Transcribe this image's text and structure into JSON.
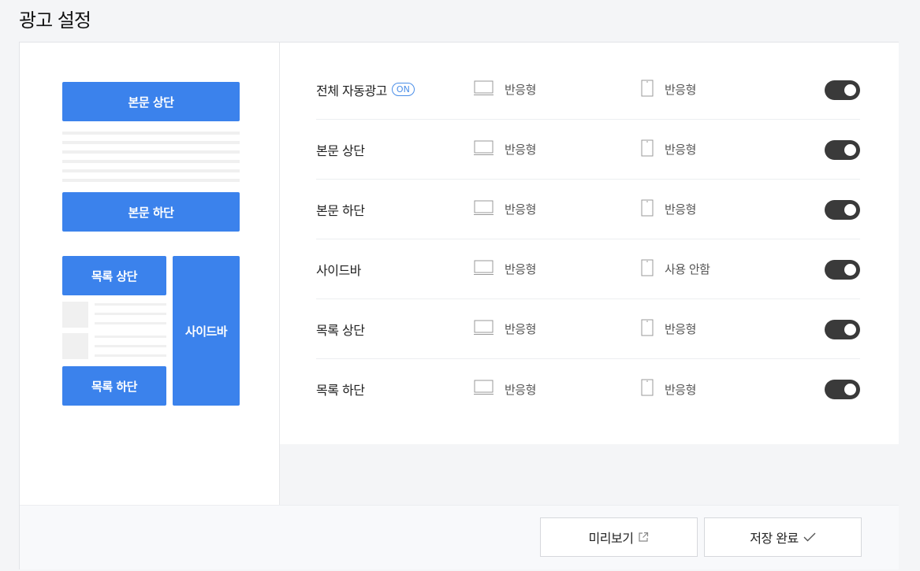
{
  "page": {
    "title": "광고 설정"
  },
  "preview": {
    "top_block": "본문 상단",
    "bottom_block": "본문 하단",
    "list_top_block": "목록 상단",
    "list_bottom_block": "목록 하단",
    "sidebar_block": "사이드바"
  },
  "settings": {
    "rows": [
      {
        "label": "전체 자동광고",
        "badge": "ON",
        "pc": "반응형",
        "mobile": "반응형",
        "enabled": true
      },
      {
        "label": "본문 상단",
        "pc": "반응형",
        "mobile": "반응형",
        "enabled": true
      },
      {
        "label": "본문 하단",
        "pc": "반응형",
        "mobile": "반응형",
        "enabled": true
      },
      {
        "label": "사이드바",
        "pc": "반응형",
        "mobile": "사용 안함",
        "enabled": true
      },
      {
        "label": "목록 상단",
        "pc": "반응형",
        "mobile": "반응형",
        "enabled": true
      },
      {
        "label": "목록 하단",
        "pc": "반응형",
        "mobile": "반응형",
        "enabled": true
      }
    ]
  },
  "footer": {
    "preview_label": "미리보기",
    "save_label": "저장 완료"
  },
  "icons": {
    "pc": "monitor-icon",
    "mobile": "phone-icon",
    "preview": "external-link-icon",
    "save": "check-icon"
  },
  "colors": {
    "accent": "#3b82ec",
    "toggle_on": "#3a3a3a",
    "badge": "#4a8ee8"
  }
}
